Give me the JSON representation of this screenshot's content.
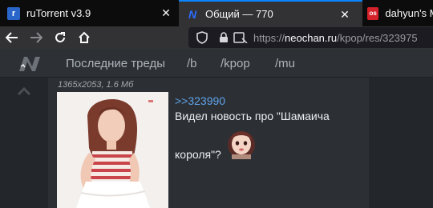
{
  "browser": {
    "tabs": [
      {
        "title": "ruTorrent v3.9",
        "favicon": "r"
      },
      {
        "title": "Общий — 770",
        "favicon": "N"
      },
      {
        "title": "dahyun's M",
        "favicon": "os"
      }
    ],
    "address": {
      "scheme": "https://",
      "host": "neochan.ru",
      "path": "/kpop/res/323975"
    }
  },
  "site": {
    "nav": {
      "recent": "Последние треды",
      "b": "/b",
      "kpop": "/kpop",
      "mu": "/mu"
    }
  },
  "post": {
    "file_meta": "1365x2053, 1.6 Мб",
    "reply_ref": ">>323990",
    "text_line1": "Видел новость про \"Шамаича",
    "text_line2": "короля\"?"
  },
  "colors": {
    "accent": "#0a84ff",
    "link": "#5fa2e8",
    "background": "#23272b"
  }
}
